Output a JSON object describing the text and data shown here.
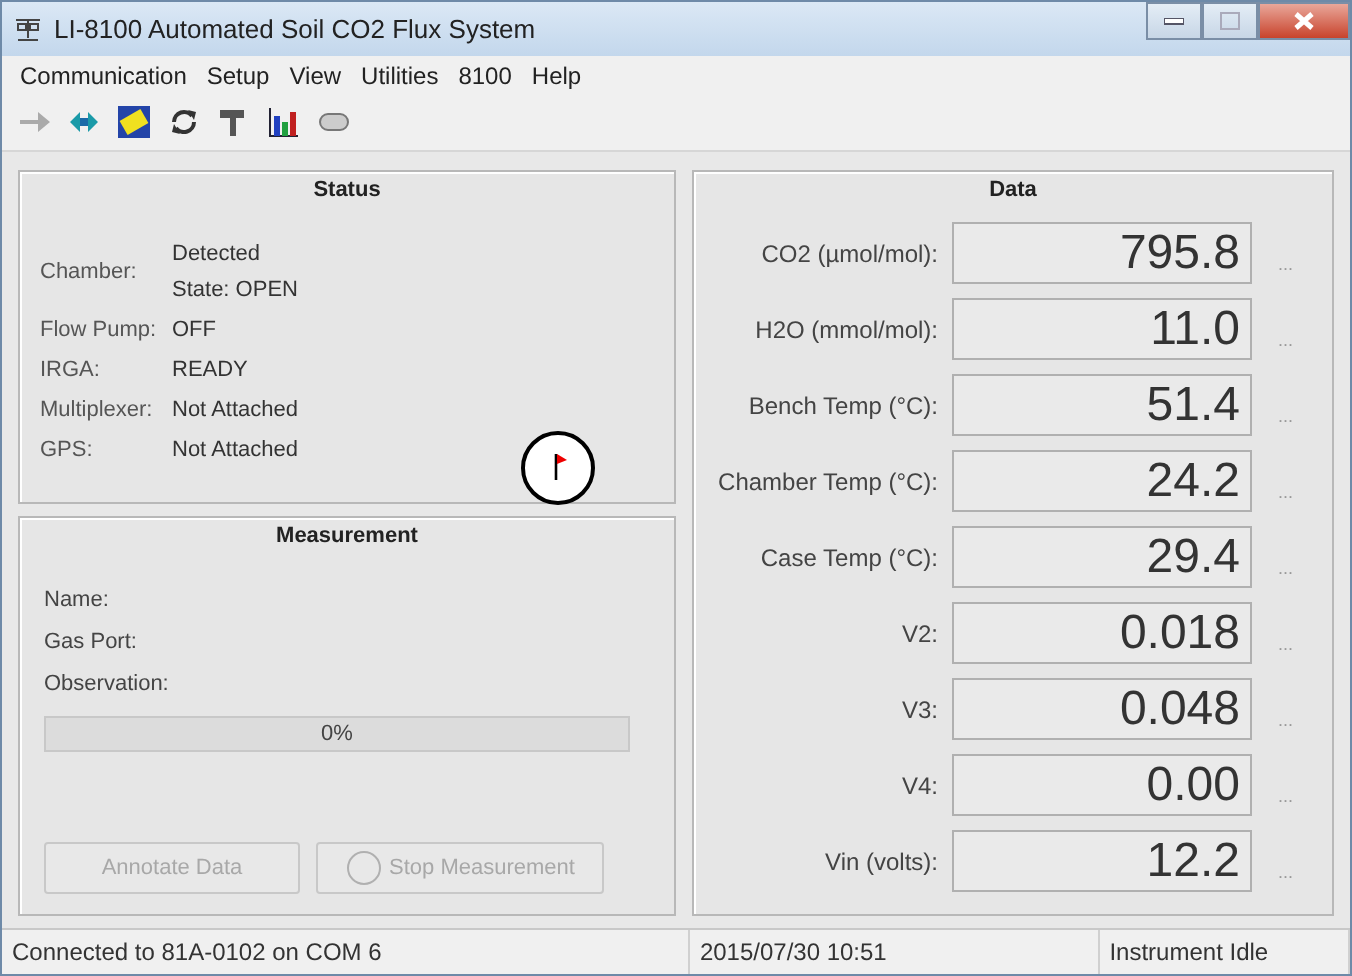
{
  "window": {
    "title": "LI-8100 Automated Soil CO2 Flux System"
  },
  "menu": [
    "Communication",
    "Setup",
    "View",
    "Utilities",
    "8100",
    "Help"
  ],
  "status": {
    "title": "Status",
    "rows": [
      {
        "label": "Chamber:",
        "values": [
          "Detected",
          "State: OPEN"
        ]
      },
      {
        "label": "Flow Pump:",
        "values": [
          "OFF"
        ]
      },
      {
        "label": "IRGA:",
        "values": [
          "READY"
        ]
      },
      {
        "label": "Multiplexer:",
        "values": [
          "Not Attached"
        ]
      },
      {
        "label": "GPS:",
        "values": [
          "Not Attached"
        ]
      }
    ]
  },
  "measurement": {
    "title": "Measurement",
    "fields": [
      "Name:",
      "Gas Port:",
      "Observation:"
    ],
    "progress": {
      "level": 0,
      "reading": "0%"
    },
    "buttons": [
      {
        "label": "Annotate Data",
        "disabled": true,
        "kind": "plain"
      },
      {
        "label": "Stop Measurement",
        "disabled": true,
        "kind": "icon"
      }
    ]
  },
  "data": {
    "title": "Data",
    "rows": [
      {
        "label": "CO2 (µmol/mol):",
        "value": "795.8",
        "more": "..."
      },
      {
        "label": "H2O (mmol/mol):",
        "value": "11.0",
        "more": "..."
      },
      {
        "label": "Bench Temp (°C):",
        "value": "51.4",
        "more": "..."
      },
      {
        "label": "Chamber Temp (°C):",
        "value": "24.2",
        "more": "..."
      },
      {
        "label": "Case Temp (°C):",
        "value": "29.4",
        "more": "..."
      },
      {
        "label": "V2:",
        "value": "0.018",
        "more": "..."
      },
      {
        "label": "V3:",
        "value": "0.048",
        "more": "..."
      },
      {
        "label": "V4:",
        "value": "0.00",
        "more": "..."
      },
      {
        "label": "Vin (volts):",
        "value": "12.2",
        "more": "..."
      }
    ]
  },
  "status_bar": [
    "Connected to 81A-0102 on COM 6",
    "2015/07/30 10:51",
    "Instrument Idle"
  ]
}
